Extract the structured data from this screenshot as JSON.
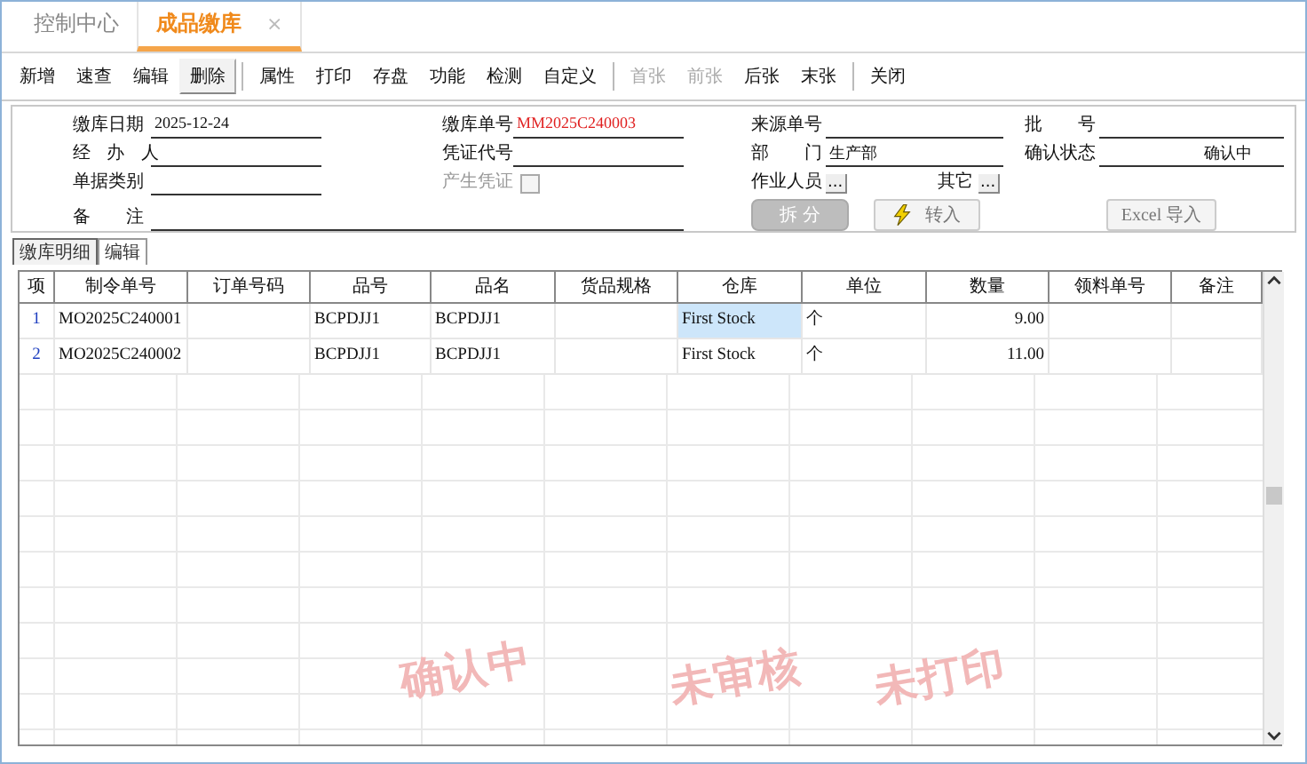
{
  "tabs": [
    {
      "label": "控制中心",
      "selected": false
    },
    {
      "label": "成品缴库",
      "selected": true,
      "close": "×"
    }
  ],
  "toolbar": [
    [
      {
        "label": "新增",
        "disabled": false,
        "selected": false
      },
      {
        "label": "速查",
        "disabled": false,
        "selected": false
      },
      {
        "label": "编辑",
        "disabled": false,
        "selected": false
      },
      {
        "label": "删除",
        "disabled": false,
        "selected": true
      }
    ],
    [
      {
        "label": "属性",
        "disabled": false,
        "selected": false
      },
      {
        "label": "打印",
        "disabled": false,
        "selected": false
      },
      {
        "label": "存盘",
        "disabled": false,
        "selected": false
      },
      {
        "label": "功能",
        "disabled": false,
        "selected": false
      },
      {
        "label": "检测",
        "disabled": false,
        "selected": false
      },
      {
        "label": "自定义",
        "disabled": false,
        "selected": false
      }
    ],
    [
      {
        "label": "首张",
        "disabled": true,
        "selected": false
      },
      {
        "label": "前张",
        "disabled": true,
        "selected": false
      },
      {
        "label": "后张",
        "disabled": false,
        "selected": false
      },
      {
        "label": "末张",
        "disabled": false,
        "selected": false
      }
    ],
    [
      {
        "label": "关闭",
        "disabled": false,
        "selected": false
      }
    ]
  ],
  "form": {
    "receipt_date": {
      "label": "缴库日期",
      "value": "2025-12-24"
    },
    "receipt_no": {
      "label": "缴库单号",
      "value": "MM2025C240003"
    },
    "source_no": {
      "label": "来源单号"
    },
    "batch_no": {
      "label": "批　　号"
    },
    "handler": {
      "label": "经 办 人"
    },
    "voucher_code": {
      "label": "凭证代号"
    },
    "department": {
      "label": "部　　门",
      "value": "生产部"
    },
    "confirm_status": {
      "label": "确认状态",
      "value": "确认中"
    },
    "doc_type": {
      "label": "单据类别"
    },
    "gen_voucher": {
      "label": "产生凭证",
      "checked": false,
      "disabled": true
    },
    "operator": {
      "label": "作业人员",
      "button": "..."
    },
    "other": {
      "label": "其它",
      "button": "..."
    },
    "remark": {
      "label": "备　　注"
    },
    "buttons": [
      {
        "kind": "split",
        "label": "拆 分",
        "disabled": true
      },
      {
        "kind": "import",
        "label": "转入",
        "disabled": false
      },
      {
        "kind": "excel",
        "label": "Excel 导入",
        "disabled": false
      }
    ]
  },
  "subtabs": [
    {
      "label": "缴库明细",
      "selected": true
    },
    {
      "label": "编辑",
      "selected": false
    }
  ],
  "table": {
    "columns": [
      "项",
      "制令单号",
      "订单号码",
      "品号",
      "品名",
      "货品规格",
      "仓库",
      "单位",
      "数量",
      "领料单号",
      "备注"
    ],
    "rows": [
      {
        "cells": [
          "1",
          "MO2025C240001",
          "",
          "BCPDJJ1",
          "BCPDJJ1",
          "",
          "First Stock",
          "个",
          "9.00",
          "",
          ""
        ],
        "selected": true
      },
      {
        "cells": [
          "2",
          "MO2025C240002",
          "",
          "BCPDJJ1",
          "BCPDJJ1",
          "",
          "First Stock",
          "个",
          "11.00",
          "",
          ""
        ],
        "selected": false
      }
    ]
  },
  "stamps": [
    "确认中",
    "未审核",
    "未打印"
  ]
}
